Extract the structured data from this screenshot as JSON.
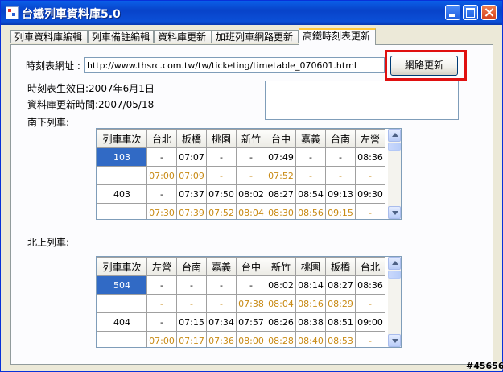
{
  "window": {
    "title": "台鐵列車資料庫5.0"
  },
  "tabs": [
    {
      "label": "列車資料庫編輯",
      "active": false
    },
    {
      "label": "列車備註編輯",
      "active": false
    },
    {
      "label": "資料庫更新",
      "active": false
    },
    {
      "label": "加班列車網路更新",
      "active": false
    },
    {
      "label": "高鐵時刻表更新",
      "active": true
    }
  ],
  "form": {
    "url_label": "時刻表網址 :",
    "url_value": "http://www.thsrc.com.tw/tw/ticketing/timetable_070601.html",
    "update_button": "網路更新",
    "effective_date": "時刻表生效日:2007年6月1日",
    "db_updated": "資料庫更新時間:2007/05/18",
    "southbound_label": "南下列車:",
    "northbound_label": "北上列車:"
  },
  "southbound": {
    "headers": [
      "列車車次",
      "台北",
      "板橋",
      "桃園",
      "新竹",
      "台中",
      "嘉義",
      "台南",
      "左營"
    ],
    "rows": [
      {
        "train": "103",
        "selected": true,
        "type": "dep",
        "cells": [
          "-",
          "07:07",
          "-",
          "-",
          "07:49",
          "-",
          "-",
          "08:36"
        ]
      },
      {
        "train": "",
        "selected": false,
        "type": "arr",
        "cells": [
          "07:00",
          "07:09",
          "-",
          "-",
          "07:52",
          "-",
          "-",
          "-"
        ]
      },
      {
        "train": "403",
        "selected": false,
        "type": "dep",
        "cells": [
          "-",
          "07:37",
          "07:50",
          "08:02",
          "08:27",
          "08:54",
          "09:13",
          "09:30"
        ]
      },
      {
        "train": "",
        "selected": false,
        "type": "arr",
        "cells": [
          "07:30",
          "07:39",
          "07:52",
          "08:04",
          "08:30",
          "08:56",
          "09:15",
          "-"
        ]
      }
    ]
  },
  "northbound": {
    "headers": [
      "列車車次",
      "左營",
      "台南",
      "嘉義",
      "台中",
      "新竹",
      "桃園",
      "板橋",
      "台北"
    ],
    "rows": [
      {
        "train": "504",
        "selected": true,
        "type": "dep",
        "cells": [
          "-",
          "-",
          "-",
          "-",
          "08:02",
          "08:14",
          "08:27",
          "08:36"
        ]
      },
      {
        "train": "",
        "selected": false,
        "type": "arr",
        "cells": [
          "-",
          "-",
          "-",
          "07:38",
          "08:04",
          "08:16",
          "08:29",
          "-"
        ]
      },
      {
        "train": "404",
        "selected": false,
        "type": "dep",
        "cells": [
          "-",
          "07:15",
          "07:34",
          "07:57",
          "08:26",
          "08:38",
          "08:51",
          "09:00"
        ]
      },
      {
        "train": "",
        "selected": false,
        "type": "arr",
        "cells": [
          "07:00",
          "07:17",
          "07:36",
          "08:00",
          "08:28",
          "08:40",
          "08:53",
          "-"
        ]
      }
    ]
  },
  "watermark": "#45656"
}
